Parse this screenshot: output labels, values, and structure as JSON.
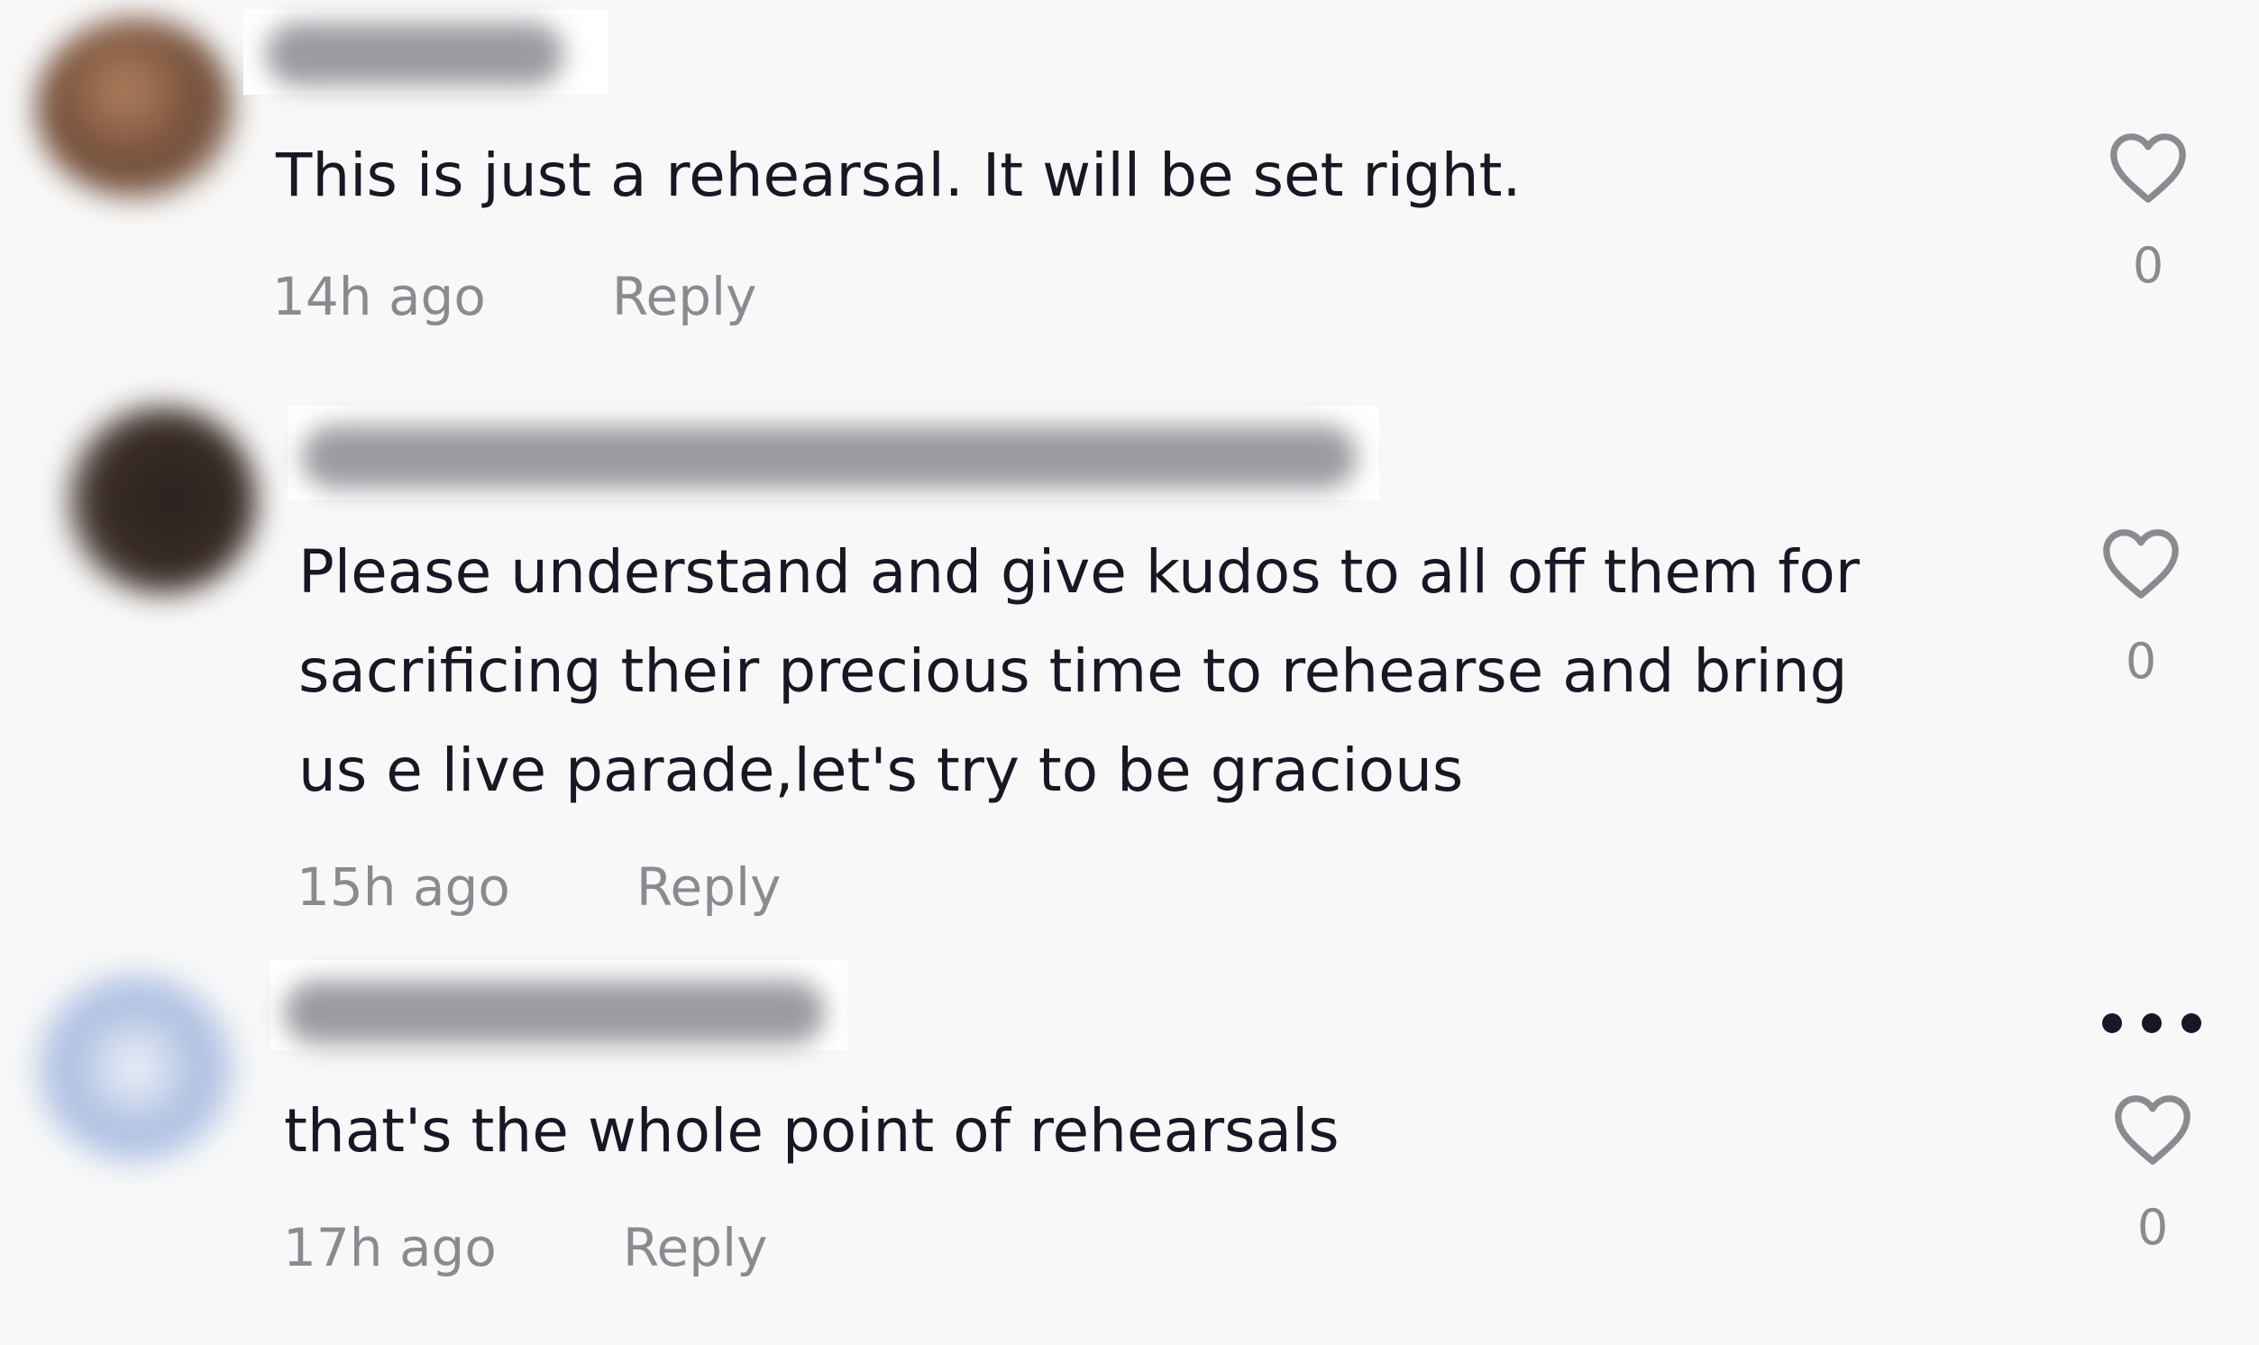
{
  "comments": [
    {
      "text": "This is just a rehearsal. It will be set right.",
      "time": "14h ago",
      "reply_label": "Reply",
      "likes": "0"
    },
    {
      "text": "Please understand and give kudos to all off them for\nsacrificing their precious time to rehearse and bring\nus e live parade,let's try to be gracious",
      "time": "15h ago",
      "reply_label": "Reply",
      "likes": "0"
    },
    {
      "text": "that's the whole point of rehearsals",
      "time": "17h ago",
      "reply_label": "Reply",
      "likes": "0"
    }
  ],
  "colors": {
    "background": "#f8f8f8",
    "text": "#161823",
    "muted": "#8a8b91"
  },
  "icons": {
    "like": "heart-outline-icon",
    "more": "more-dots-icon"
  }
}
